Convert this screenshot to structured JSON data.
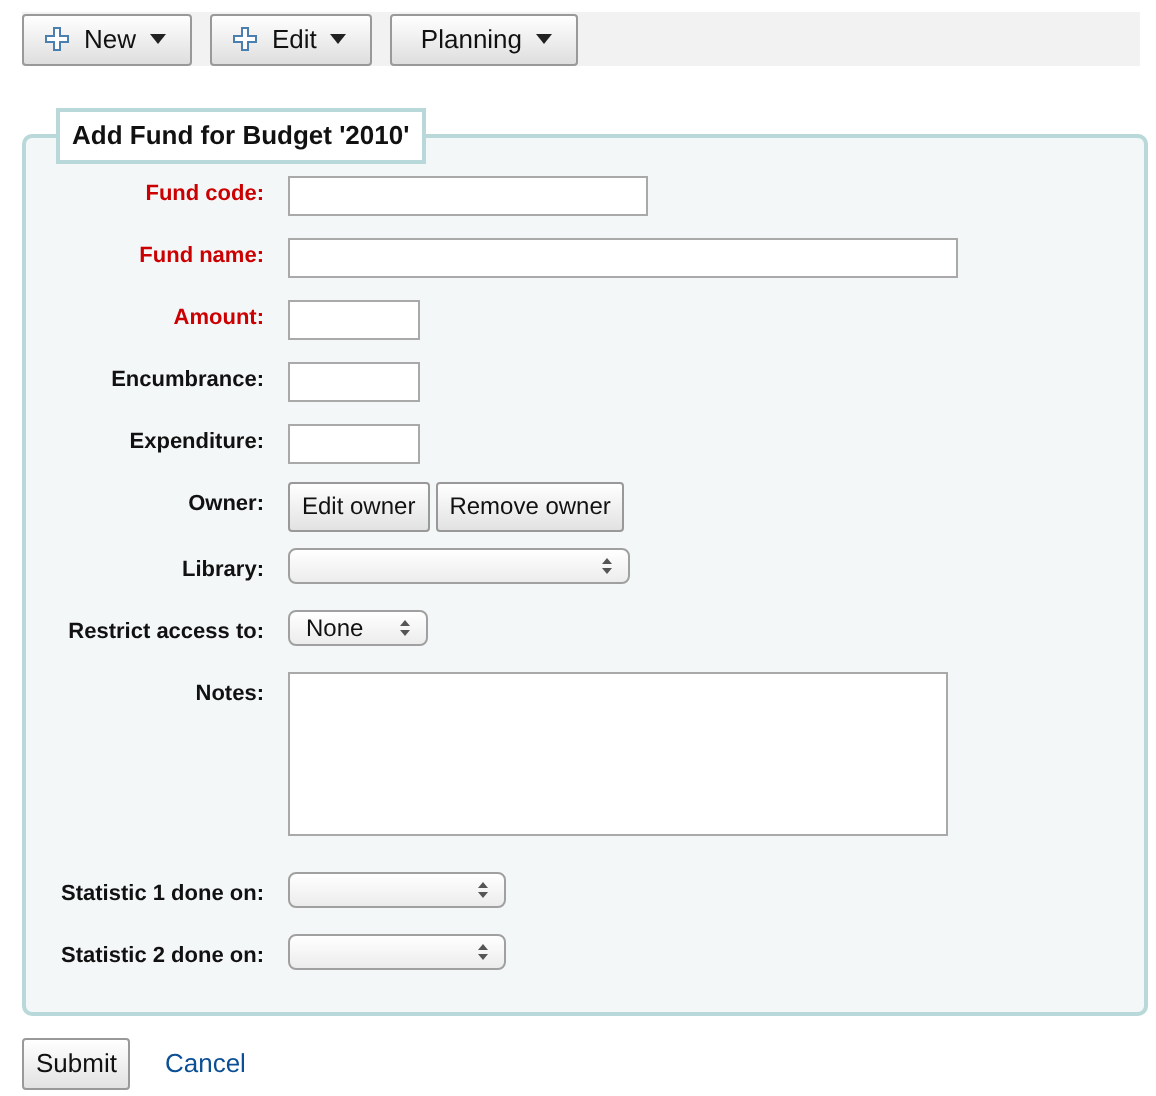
{
  "toolbar": [
    {
      "label": "New",
      "plus": true
    },
    {
      "label": "Edit",
      "plus": true
    },
    {
      "label": "Planning",
      "plus": false
    }
  ],
  "form": {
    "legend": "Add Fund for Budget '2010'",
    "rows": [
      {
        "label": "Fund code:",
        "required": true,
        "kind": "text"
      },
      {
        "label": "Fund name:",
        "required": true,
        "kind": "text"
      },
      {
        "label": "Amount:",
        "required": true,
        "kind": "text"
      },
      {
        "label": "Encumbrance:",
        "required": false,
        "kind": "text"
      },
      {
        "label": "Expenditure:",
        "required": false,
        "kind": "text"
      },
      {
        "label": "Owner:",
        "required": false,
        "kind": "buttons",
        "buttons": [
          "Edit owner",
          "Remove owner"
        ]
      },
      {
        "label": "Library:",
        "required": false,
        "kind": "select"
      },
      {
        "label": "Restrict access to:",
        "required": false,
        "kind": "select",
        "value": "None"
      },
      {
        "label": "Notes:",
        "required": false,
        "kind": "textarea"
      },
      {
        "label": "Statistic 1 done on:",
        "required": false,
        "kind": "select"
      },
      {
        "label": "Statistic 2 done on:",
        "required": false,
        "kind": "select"
      }
    ]
  },
  "actions": {
    "submit": "Submit",
    "cancel": "Cancel"
  }
}
